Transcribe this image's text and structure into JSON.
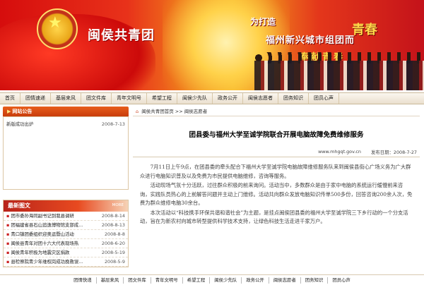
{
  "banner": {
    "site_name": "闽侯共青团",
    "slogan_line1": "为打造",
    "slogan_line2": "福州新兴城市组团而",
    "slogan_line3": "奉献青春",
    "calligraphy": "青春"
  },
  "nav": [
    "首页",
    "团情速递",
    "基层来风",
    "团文件库",
    "青年文明号",
    "希望工程",
    "闽侯少先队",
    "政务公开",
    "闽侯志愿者",
    "团务知识",
    "团员心声"
  ],
  "notice": {
    "title": "网站公告",
    "items": [
      {
        "text": "新版成功出炉",
        "date": "2008-7-13"
      }
    ]
  },
  "news": {
    "title": "最新图文",
    "more": "MORE",
    "items": [
      {
        "text": "团市委孙海同副书记到我县调研",
        "date": "2008-8-14"
      },
      {
        "text": "团福建省县石山追逸博物馆支部成...",
        "date": "2008-8-13"
      },
      {
        "text": "青口镇团委组织迎奥运暨山活动",
        "date": "2008-8-8"
      },
      {
        "text": "闽侯县青年对团十六大代表现场热",
        "date": "2008-6-20"
      },
      {
        "text": "闽侯青年积极为地震灾区捐款",
        "date": "2008-5-19"
      },
      {
        "text": "县检察院青少年维权岗成功挽救误...",
        "date": "2008-5-9"
      }
    ]
  },
  "breadcrumb": {
    "home": "闽侯共青团首页",
    "sep": ">>",
    "current": "闽侯志愿者"
  },
  "article": {
    "title": "团县委与福州大学至诚学院联合开展电脑故障免费维修服务",
    "source": "www.mhgqt.gov.cn",
    "date": "发布日期：2008-7-27",
    "paragraphs": [
      "7月11日上午9点，在团县委的牵头配合下福州大学至诚学院电脑故障维修服务队来到闽侯县街心广场义务为广大群众进行电脑知识普及以及免费为市民提供电脑维修，咨询等服务。",
      "活动现场气氛十分活跃，过往群众积极的前来询问。活动当中，多数群众是由于家中电脑的系统运行缓慢前来咨询，实践队员热心的上前解答问题并主动上门维修。活动共向群众发放电脑知识传单500多份，回答咨询200余人次，免费为群众维修电脑30余台。",
      "本次活动以“科技携手环保共谐和谐社会”为主题，是挂点闽侯团县委的福州大学至诚学院三下乡行动的一个分支活动，旨在为新农村向城市转型提供科学技术支持，让绿色科技生活走进千家万户。"
    ]
  },
  "footer": [
    "团情快递",
    "基层来风",
    "团文件库",
    "青年文明号",
    "希望工程",
    "闽侯少先队",
    "政务公开",
    "闽侯志愿者",
    "团务知识",
    "团员心声"
  ],
  "colors": {
    "header_red": "#d60d0d",
    "accent_orange": "#e85e1c",
    "nav_bg": "#eadfce"
  }
}
